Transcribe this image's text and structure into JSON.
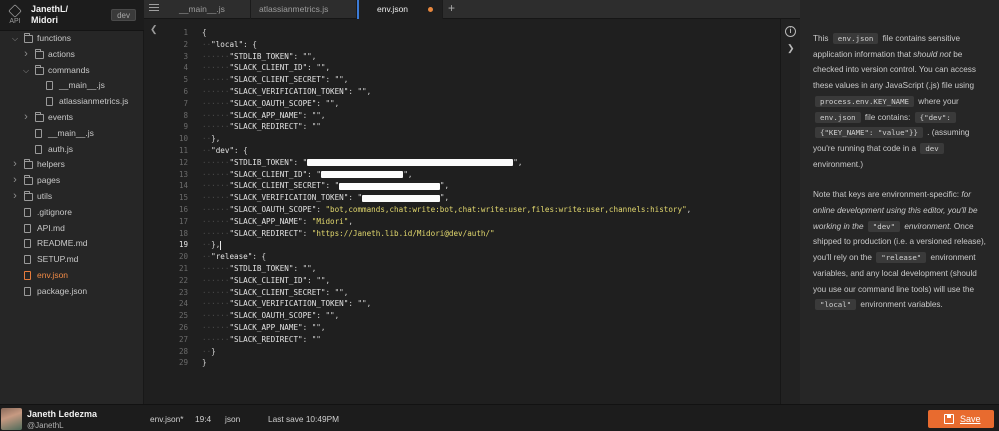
{
  "project": {
    "owner_line": "JanethL/",
    "name_line": "Midori",
    "env_badge": "dev",
    "logo_text": "API"
  },
  "sidebar": {
    "rows": [
      {
        "name": "functions",
        "type": "folder",
        "depth": 0,
        "expanded": true
      },
      {
        "name": "actions",
        "type": "folder",
        "depth": 1,
        "expanded": false
      },
      {
        "name": "commands",
        "type": "folder",
        "depth": 1,
        "expanded": true
      },
      {
        "name": "__main__.js",
        "type": "file",
        "depth": 2
      },
      {
        "name": "atlassianmetrics.js",
        "type": "file",
        "depth": 2
      },
      {
        "name": "events",
        "type": "folder",
        "depth": 1,
        "expanded": false
      },
      {
        "name": "__main__.js",
        "type": "file",
        "depth": 1
      },
      {
        "name": "auth.js",
        "type": "file",
        "depth": 1
      },
      {
        "name": "helpers",
        "type": "folder",
        "depth": 0,
        "expanded": false
      },
      {
        "name": "pages",
        "type": "folder",
        "depth": 0,
        "expanded": false
      },
      {
        "name": "utils",
        "type": "folder",
        "depth": 0,
        "expanded": false
      },
      {
        "name": ".gitignore",
        "type": "file",
        "depth": 0
      },
      {
        "name": "API.md",
        "type": "file",
        "depth": 0
      },
      {
        "name": "README.md",
        "type": "file",
        "depth": 0
      },
      {
        "name": "SETUP.md",
        "type": "file",
        "depth": 0
      },
      {
        "name": "env.json",
        "type": "file",
        "depth": 0,
        "active": true
      },
      {
        "name": "package.json",
        "type": "file",
        "depth": 0
      }
    ]
  },
  "user": {
    "name": "Janeth Ledezma",
    "handle": "@JanethL"
  },
  "tabs": [
    {
      "label": "__main__.js",
      "active": false
    },
    {
      "label": "atlassianmetrics.js",
      "active": false
    },
    {
      "label": "env.json",
      "active": true,
      "modified": true
    }
  ],
  "editor": {
    "current_line": 19,
    "lines": [
      {
        "indent": 0,
        "text": "{"
      },
      {
        "indent": 1,
        "key": "\"local\"",
        "text": ": {"
      },
      {
        "indent": 2,
        "key": "\"STDLIB_TOKEN\"",
        "text": ": \"\","
      },
      {
        "indent": 2,
        "key": "\"SLACK_CLIENT_ID\"",
        "text": ": \"\","
      },
      {
        "indent": 2,
        "key": "\"SLACK_CLIENT_SECRET\"",
        "text": ": \"\","
      },
      {
        "indent": 2,
        "key": "\"SLACK_VERIFICATION_TOKEN\"",
        "text": ": \"\","
      },
      {
        "indent": 2,
        "key": "\"SLACK_OAUTH_SCOPE\"",
        "text": ": \"\","
      },
      {
        "indent": 2,
        "key": "\"SLACK_APP_NAME\"",
        "text": ": \"\","
      },
      {
        "indent": 2,
        "key": "\"SLACK_REDIRECT\"",
        "text": ": \"\""
      },
      {
        "indent": 1,
        "text": "},"
      },
      {
        "indent": 1,
        "key": "\"dev\"",
        "text": ": {"
      },
      {
        "indent": 2,
        "key": "\"STDLIB_TOKEN\"",
        "text": ": \"",
        "redact": 45,
        "tail": "\","
      },
      {
        "indent": 2,
        "key": "\"SLACK_CLIENT_ID\"",
        "text": ": \"",
        "redact": 18,
        "tail": "\","
      },
      {
        "indent": 2,
        "key": "\"SLACK_CLIENT_SECRET\"",
        "text": ": \"",
        "redact": 22,
        "tail": "\","
      },
      {
        "indent": 2,
        "key": "\"SLACK_VERIFICATION_TOKEN\"",
        "text": ": \"",
        "redact": 17,
        "tail": "\","
      },
      {
        "indent": 2,
        "key": "\"SLACK_OAUTH_SCOPE\"",
        "text": ": ",
        "str": "\"bot,commands,chat:write:bot,chat:write:user,files:write:user,channels:history\"",
        "tail": ","
      },
      {
        "indent": 2,
        "key": "\"SLACK_APP_NAME\"",
        "text": ": ",
        "str": "\"Midori\"",
        "tail": ","
      },
      {
        "indent": 2,
        "key": "\"SLACK_REDIRECT\"",
        "text": ": ",
        "str": "\"https://Janeth.lib.id/Midori@dev/auth/\"",
        "tail": ""
      },
      {
        "indent": 1,
        "text": "},",
        "cursor": true
      },
      {
        "indent": 1,
        "key": "\"release\"",
        "text": ": {"
      },
      {
        "indent": 2,
        "key": "\"STDLIB_TOKEN\"",
        "text": ": \"\","
      },
      {
        "indent": 2,
        "key": "\"SLACK_CLIENT_ID\"",
        "text": ": \"\","
      },
      {
        "indent": 2,
        "key": "\"SLACK_CLIENT_SECRET\"",
        "text": ": \"\","
      },
      {
        "indent": 2,
        "key": "\"SLACK_VERIFICATION_TOKEN\"",
        "text": ": \"\","
      },
      {
        "indent": 2,
        "key": "\"SLACK_OAUTH_SCOPE\"",
        "text": ": \"\","
      },
      {
        "indent": 2,
        "key": "\"SLACK_APP_NAME\"",
        "text": ": \"\","
      },
      {
        "indent": 2,
        "key": "\"SLACK_REDIRECT\"",
        "text": ": \"\""
      },
      {
        "indent": 1,
        "text": "}"
      },
      {
        "indent": 0,
        "text": "}"
      }
    ]
  },
  "help": {
    "p1": [
      {
        "t": "This "
      },
      {
        "c": "env.json"
      },
      {
        "t": " file contains sensitive application information that "
      },
      {
        "i": "should not"
      },
      {
        "t": " be checked into version control. You can access these values in any JavaScript (.js) file using "
      },
      {
        "c": "process.env.KEY_NAME"
      },
      {
        "t": " where your "
      },
      {
        "c": "env.json"
      },
      {
        "t": " file contains: "
      },
      {
        "c": "{\"dev\":"
      },
      {
        "t": " "
      },
      {
        "c": "{\"KEY_NAME\": \"value\"}}"
      },
      {
        "t": " . (assuming you're running that code in a "
      },
      {
        "c": "dev"
      },
      {
        "t": " environment.)"
      }
    ],
    "p2": [
      {
        "t": "Note that keys are environment-specific: "
      },
      {
        "i": "for online development using this editor, you'll be working in the "
      },
      {
        "c": "\"dev\""
      },
      {
        "i": " environment."
      },
      {
        "t": " Once shipped to production (i.e. a versioned release), you'll rely on the "
      },
      {
        "c": "\"release\""
      },
      {
        "t": " environment variables, and any local development (should you use our command line tools) will use the "
      },
      {
        "c": "\"local\""
      },
      {
        "t": " environment variables."
      }
    ]
  },
  "status": {
    "file": "env.json*",
    "position": "19:4",
    "mode": "json",
    "last_save": "Last save 10:49PM",
    "save_label": "Save"
  },
  "colors": {
    "accent": "#e86b2f",
    "active_tab": "#3c7bd6",
    "string": "#e2d86e"
  }
}
